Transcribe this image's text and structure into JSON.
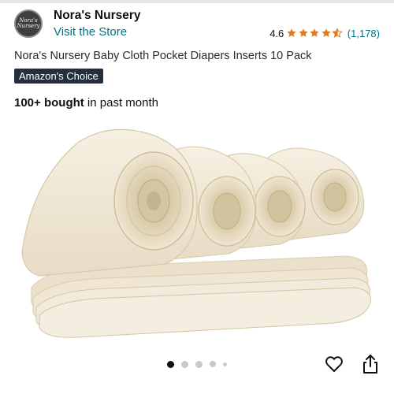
{
  "seller": {
    "logo_text": "Nora's\nNursery",
    "name": "Nora's Nursery",
    "store_link": "Visit the Store"
  },
  "rating": {
    "value": "4.6",
    "stars": 4.6,
    "count": "(1,178)",
    "star_color": "#de7921"
  },
  "product": {
    "title": "Nora's Nursery Baby Cloth Pocket Diapers Inserts 10 Pack",
    "badge": "Amazon's Choice",
    "bought_strong": "100+ bought",
    "bought_rest": " in past month"
  },
  "carousel": {
    "dots": 5,
    "active_index": 0
  },
  "actions": {
    "wishlist_icon": "heart-icon",
    "share_icon": "share-icon"
  },
  "colors": {
    "link": "#007185",
    "badge_bg": "#232f3e",
    "text": "#0f1111"
  }
}
